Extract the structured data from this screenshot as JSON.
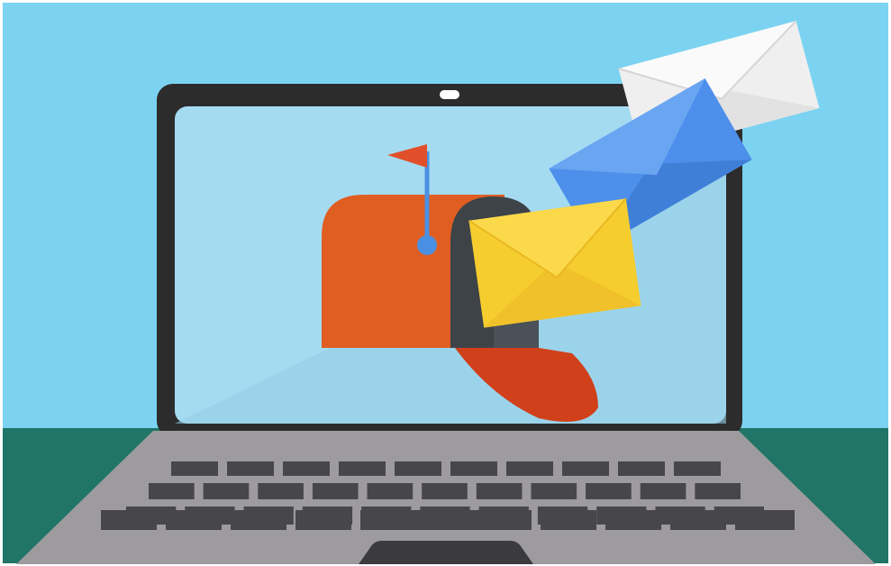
{
  "illustration": {
    "subject": "laptop-with-mailbox-and-envelopes",
    "colors": {
      "sky": "#7bd3f1",
      "floor": "#207566",
      "laptop_frame": "#2c2c2c",
      "screen": "#a5dbf1",
      "keyboard_deck": "#9d9b9e",
      "key": "#474649",
      "trackpad": "#3b3a3d",
      "mailbox_body": "#e05e22",
      "mailbox_opening": "#3e4348",
      "mailbox_door": "#d0401b",
      "flag": "#e04f2a",
      "flag_pole": "#4a90e2",
      "envelope_yellow": "#f6cd2f",
      "envelope_blue": "#4d8fea",
      "envelope_white": "#efefef"
    },
    "icons": [
      "mailbox-icon",
      "envelope-icon",
      "laptop-icon",
      "flag-icon"
    ]
  }
}
